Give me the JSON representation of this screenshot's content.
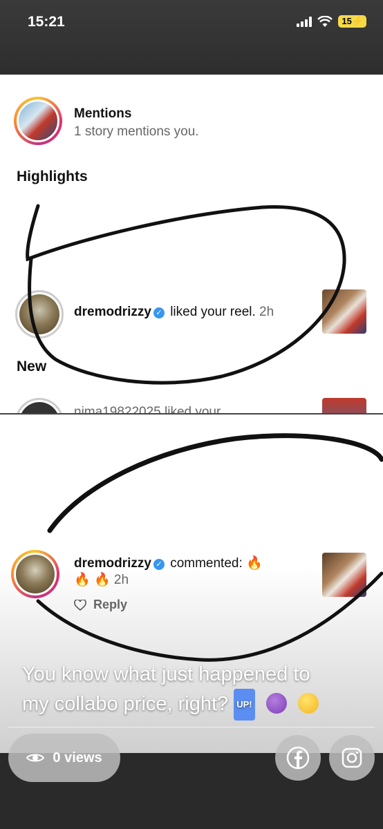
{
  "status_bar": {
    "time": "15:21",
    "battery": "15"
  },
  "screenshot1": {
    "mentions_title": "Mentions",
    "mentions_subtitle": "1 story mentions you.",
    "highlights_heading": "Highlights",
    "highlight_user": "dremodrizzy",
    "highlight_action": "liked your reel.",
    "highlight_time": "2h",
    "new_heading": "New",
    "new_item_partial": "nima19822025 liked your"
  },
  "screenshot2": {
    "user": "dremodrizzy",
    "action": "commented:",
    "time": "2h",
    "reply_label": "Reply"
  },
  "caption": {
    "line1": "You know what just happened to",
    "line2": "my collabo price, right?",
    "up_badge": "UP!"
  },
  "footer": {
    "views_label": "0 views"
  },
  "colors": {
    "verified": "#3797f0",
    "ring_start": "#f7c531",
    "ring_end": "#e1306c"
  },
  "icons": [
    "eye-icon",
    "facebook-icon",
    "instagram-icon",
    "heart-icon",
    "verified-icon",
    "fire-icon",
    "devil-emoji-icon",
    "wink-emoji-icon"
  ]
}
